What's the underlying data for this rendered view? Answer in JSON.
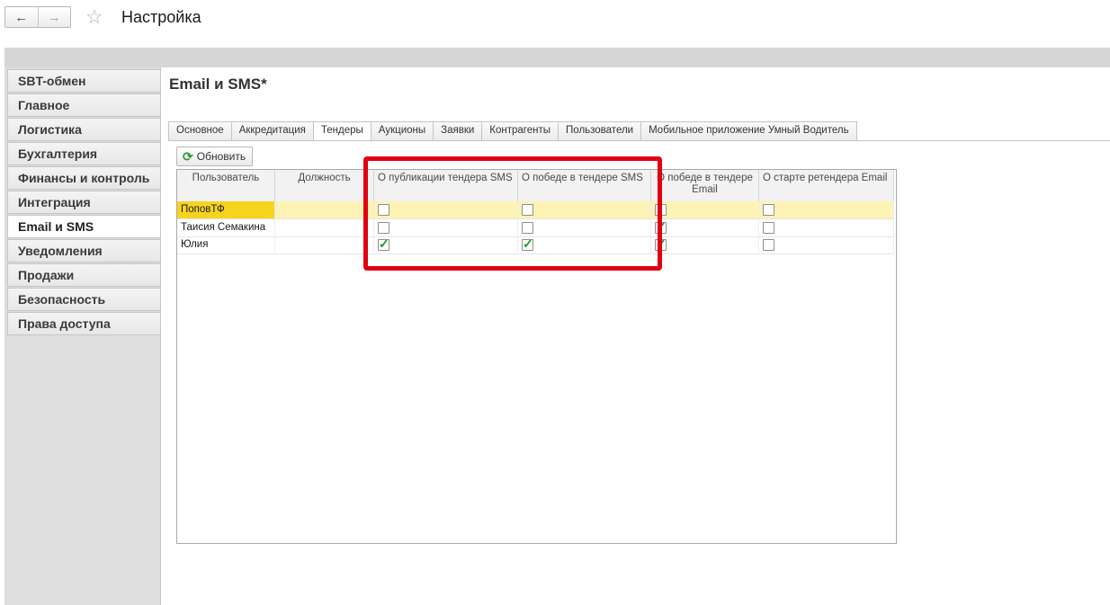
{
  "topbar": {
    "title": "Настройка",
    "back_icon": "←",
    "forward_icon": "→",
    "star_icon": "☆"
  },
  "sidebar": {
    "items": [
      {
        "label": "SBT-обмен",
        "active": false
      },
      {
        "label": "Главное",
        "active": false
      },
      {
        "label": "Логистика",
        "active": false
      },
      {
        "label": "Бухгалтерия",
        "active": false
      },
      {
        "label": "Финансы и контроль",
        "active": false
      },
      {
        "label": "Интеграция",
        "active": false
      },
      {
        "label": "Email и SMS",
        "active": true
      },
      {
        "label": "Уведомления",
        "active": false
      },
      {
        "label": "Продажи",
        "active": false
      },
      {
        "label": "Безопасность",
        "active": false
      },
      {
        "label": "Права доступа",
        "active": false
      }
    ]
  },
  "main": {
    "heading": "Email и SMS*",
    "tabs": [
      {
        "label": "Основное",
        "active": false
      },
      {
        "label": "Аккредитация",
        "active": false
      },
      {
        "label": "Тендеры",
        "active": true
      },
      {
        "label": "Аукционы",
        "active": false
      },
      {
        "label": "Заявки",
        "active": false
      },
      {
        "label": "Контрагенты",
        "active": false
      },
      {
        "label": "Пользователи",
        "active": false
      },
      {
        "label": "Мобильное приложение Умный Водитель",
        "active": false
      }
    ],
    "refresh_label": "Обновить",
    "refresh_icon": "⟳"
  },
  "table": {
    "columns": [
      "Пользователь",
      "Должность",
      "О публикации тендера SMS",
      "О победе в тендере SMS",
      "О победе в тендере Email",
      "О старте ретендера Email"
    ],
    "rows": [
      {
        "user": "ПоповТФ",
        "position": "",
        "pub_sms": false,
        "win_sms": false,
        "win_email": false,
        "retender_email": false
      },
      {
        "user": "Таисия Семакина",
        "position": "",
        "pub_sms": false,
        "win_sms": false,
        "win_email": true,
        "retender_email": false
      },
      {
        "user": "Юлия",
        "position": "",
        "pub_sms": true,
        "win_sms": true,
        "win_email": true,
        "retender_email": false
      }
    ]
  },
  "colors": {
    "highlight": "#e00012",
    "selected_row": "#fcf3b5",
    "current_cell": "#f6d31f",
    "check": "#1c9a2e"
  }
}
